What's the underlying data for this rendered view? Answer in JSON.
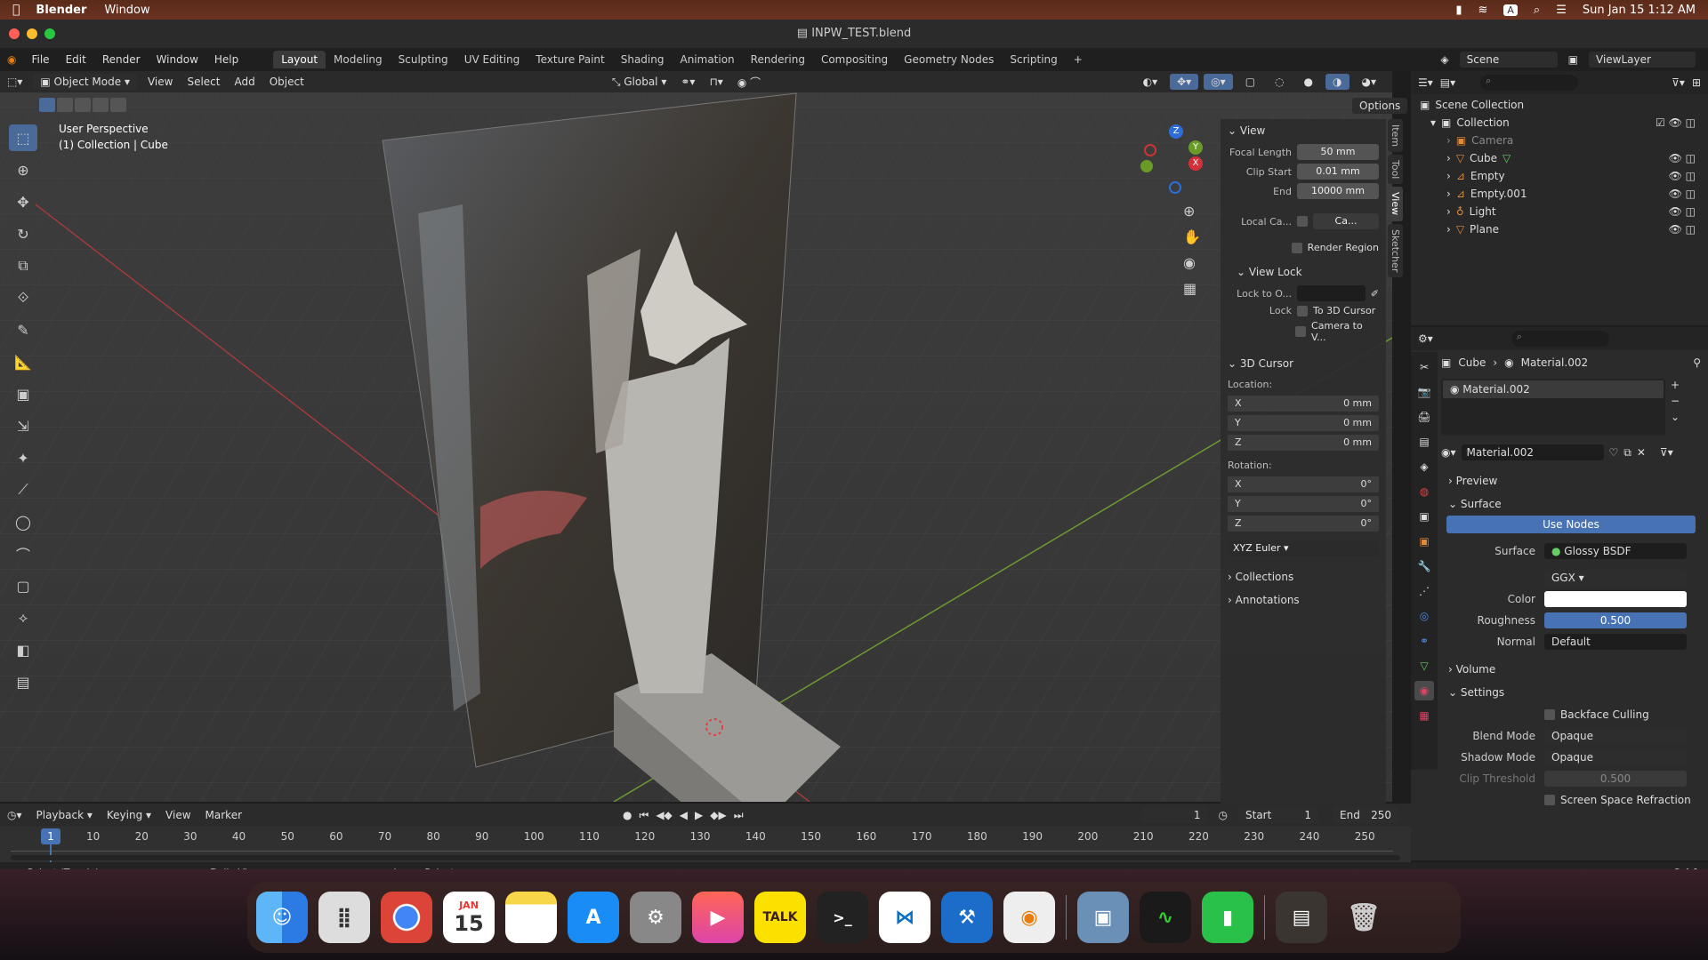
{
  "macbar": {
    "app": "Blender",
    "menu": "Window",
    "clock": "Sun Jan 15  1:12 AM",
    "input_badge": "A"
  },
  "window": {
    "title": "INPW_TEST.blend"
  },
  "menu": {
    "items": [
      "File",
      "Edit",
      "Render",
      "Window",
      "Help"
    ]
  },
  "workspaces": [
    "Layout",
    "Modeling",
    "Sculpting",
    "UV Editing",
    "Texture Paint",
    "Shading",
    "Animation",
    "Rendering",
    "Compositing",
    "Geometry Nodes",
    "Scripting"
  ],
  "scene": {
    "label": "Scene",
    "viewlayer": "ViewLayer"
  },
  "viewport": {
    "mode": "Object Mode",
    "menus": [
      "View",
      "Select",
      "Add",
      "Object"
    ],
    "orientation": "Global",
    "options": "Options",
    "overlay_title": "User Perspective",
    "overlay_sub": "(1) Collection | Cube",
    "gizmo": {
      "x": "X",
      "y": "Y",
      "z": "Z"
    }
  },
  "npanel": {
    "view": "View",
    "focal_label": "Focal Length",
    "focal": "50 mm",
    "clip_start_label": "Clip Start",
    "clip_start": "0.01 mm",
    "clip_end_label": "End",
    "clip_end": "10000 mm",
    "local_cam_label": "Local Ca...",
    "local_cam_value": "Ca...",
    "render_region": "Render Region",
    "view_lock": "View Lock",
    "lock_to_obj": "Lock to O...",
    "lock_label": "Lock",
    "to_3d_cursor": "To 3D Cursor",
    "camera_to_view": "Camera to V...",
    "cursor": "3D Cursor",
    "location": "Location:",
    "rotation": "Rotation:",
    "lx": "0 mm",
    "ly": "0 mm",
    "lz": "0 mm",
    "rx": "0°",
    "ry": "0°",
    "rz": "0°",
    "ax": "X",
    "ay": "Y",
    "az": "Z",
    "euler": "XYZ Euler",
    "collections": "Collections",
    "annotations": "Annotations",
    "tabs": [
      "Item",
      "Tool",
      "View",
      "Sketcher"
    ]
  },
  "outliner": {
    "root": "Scene Collection",
    "collection": "Collection",
    "items": [
      "Camera",
      "Cube",
      "Empty",
      "Empty.001",
      "Light",
      "Plane"
    ]
  },
  "properties": {
    "breadcrumb_obj": "Cube",
    "breadcrumb_mat": "Material.002",
    "slot": "Material.002",
    "material": "Material.002",
    "preview": "Preview",
    "surface_header": "Surface",
    "use_nodes": "Use Nodes",
    "surface_label": "Surface",
    "surface_value": "Glossy BSDF",
    "distribution": "GGX",
    "color_label": "Color",
    "roughness_label": "Roughness",
    "roughness": "0.500",
    "normal_label": "Normal",
    "normal": "Default",
    "volume": "Volume",
    "settings": "Settings",
    "backface": "Backface Culling",
    "blend_label": "Blend Mode",
    "blend": "Opaque",
    "shadow_label": "Shadow Mode",
    "shadow": "Opaque",
    "clip_label": "Clip Threshold",
    "clip": "0.500",
    "ssr": "Screen Space Refraction",
    "version": "3.4.1"
  },
  "timeline": {
    "menus": [
      "Playback",
      "Keying",
      "View",
      "Marker"
    ],
    "current": "1",
    "start_label": "Start",
    "start": "1",
    "end_label": "End",
    "end": "250",
    "ticks": [
      "1",
      "10",
      "20",
      "30",
      "40",
      "50",
      "60",
      "70",
      "80",
      "90",
      "100",
      "110",
      "120",
      "130",
      "140",
      "150",
      "160",
      "170",
      "180",
      "190",
      "200",
      "210",
      "220",
      "230",
      "240",
      "250"
    ]
  },
  "status": {
    "select": "Select (Toggle)",
    "dolly": "Dolly View",
    "lasso": "Lasso Select"
  },
  "dock": {
    "calendar_month": "JAN",
    "calendar_day": "15",
    "talk": "TALK"
  }
}
